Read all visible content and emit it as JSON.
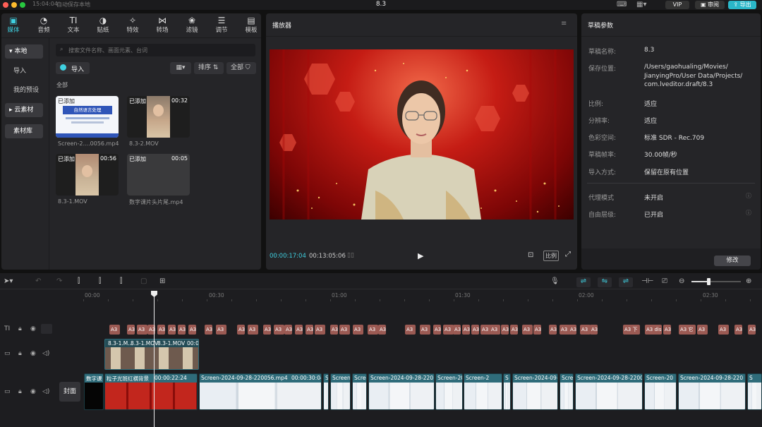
{
  "titlebar": {
    "time": "15:04:04",
    "autosave": "自动保存本地",
    "project": "8.3",
    "vip": "VIP",
    "review": "审阅",
    "export": "导出"
  },
  "toolbar": [
    "媒体",
    "音频",
    "文本",
    "贴纸",
    "特效",
    "转场",
    "滤镜",
    "调节",
    "模板"
  ],
  "sidebar": {
    "local": "本地",
    "import": "导入",
    "presets": "我的预设",
    "cloud": "云素材",
    "library": "素材库"
  },
  "media": {
    "search_placeholder": "搜索文件名称、画面元素、台词",
    "import_btn": "导入",
    "sort": "排序",
    "all_filter": "全部",
    "section": "全部",
    "items": [
      {
        "badge": "已添加",
        "dur": "",
        "name": "Screen-2....0056.mp4",
        "thumb_title": "自然语言处理"
      },
      {
        "badge": "已添加",
        "dur": "00:32",
        "name": "8.3-2.MOV"
      },
      {
        "badge": "已添加",
        "dur": "00:56",
        "name": "8.3-1.MOV"
      },
      {
        "badge": "已添加",
        "dur": "00:05",
        "name": "数字课片头片尾.mp4"
      }
    ]
  },
  "player": {
    "title": "播放器",
    "current": "00:00:17:04",
    "total": "00:13:05:06",
    "ratio": "比例"
  },
  "draft": {
    "title": "草稿参数",
    "rows": [
      {
        "label": "草稿名称:",
        "value": "8.3"
      },
      {
        "label": "保存位置:",
        "value": "/Users/gaohualing/Movies/\nJianyingPro/User Data/Projects/\ncom.lveditor.draft/8.3"
      },
      {
        "label": "比例:",
        "value": "适应"
      },
      {
        "label": "分辨率:",
        "value": "适应"
      },
      {
        "label": "色彩空间:",
        "value": "标准 SDR - Rec.709"
      },
      {
        "label": "草稿帧率:",
        "value": "30.00帧/秒"
      },
      {
        "label": "导入方式:",
        "value": "保留在原有位置"
      },
      {
        "label": "代理模式",
        "value": "未开启"
      },
      {
        "label": "自由层级:",
        "value": "已开启"
      }
    ],
    "modify": "修改"
  },
  "timeline": {
    "ruler": [
      "00:00",
      "00:30",
      "01:00",
      "01:30",
      "02:00",
      "02:30"
    ],
    "cover": "封面",
    "text_chip": "A3",
    "text_chip_extra": [
      "A3 下",
      "A3 dis",
      "A3 它"
    ],
    "overlay_clips": [
      "8.3-1.M...",
      "8.3-1.MOV",
      "8.3-1.MOV",
      "00:0"
    ],
    "main_clips": [
      {
        "label": "数字课",
        "w": 28
      },
      {
        "label": "粒子光斑红横背景",
        "extra": "00:00:22:24"
      },
      {
        "label": "Screen-2024-09-28-220056.mp4",
        "extra": "00:00:30:04"
      },
      {
        "label": "S"
      },
      {
        "label": "Screen"
      },
      {
        "label": "Scree"
      },
      {
        "label": "Screen-2024-09-28-220"
      },
      {
        "label": "Screen-20"
      },
      {
        "label": "Screen-2"
      },
      {
        "label": "S"
      },
      {
        "label": "Screen-2024-09-"
      },
      {
        "label": "Scre"
      },
      {
        "label": "Screen-2024-09-28-2200"
      },
      {
        "label": "Screen-20"
      },
      {
        "label": "Screen-2024-09-28-220"
      },
      {
        "label": "S"
      }
    ]
  }
}
